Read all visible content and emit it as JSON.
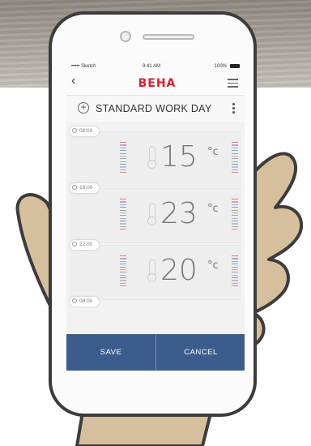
{
  "status": {
    "carrier": "••••• Sketch",
    "time": "9:41 AM",
    "battery": "100%"
  },
  "app": {
    "brand": "BEHA"
  },
  "program": {
    "title": "STANDARD WORK DAY"
  },
  "slots": [
    {
      "start": "08:00",
      "temp": "15",
      "unit": "°c"
    },
    {
      "start": "16:00",
      "temp": "23",
      "unit": "°c"
    },
    {
      "start": "22:00",
      "temp": "20",
      "unit": "°c"
    },
    {
      "start": "08:00"
    }
  ],
  "actions": {
    "save": "SAVE",
    "cancel": "CANCEL"
  },
  "colors": {
    "brand": "#e0202a",
    "action_bar": "#3d5c8e",
    "skin": "#d6bf9c"
  }
}
